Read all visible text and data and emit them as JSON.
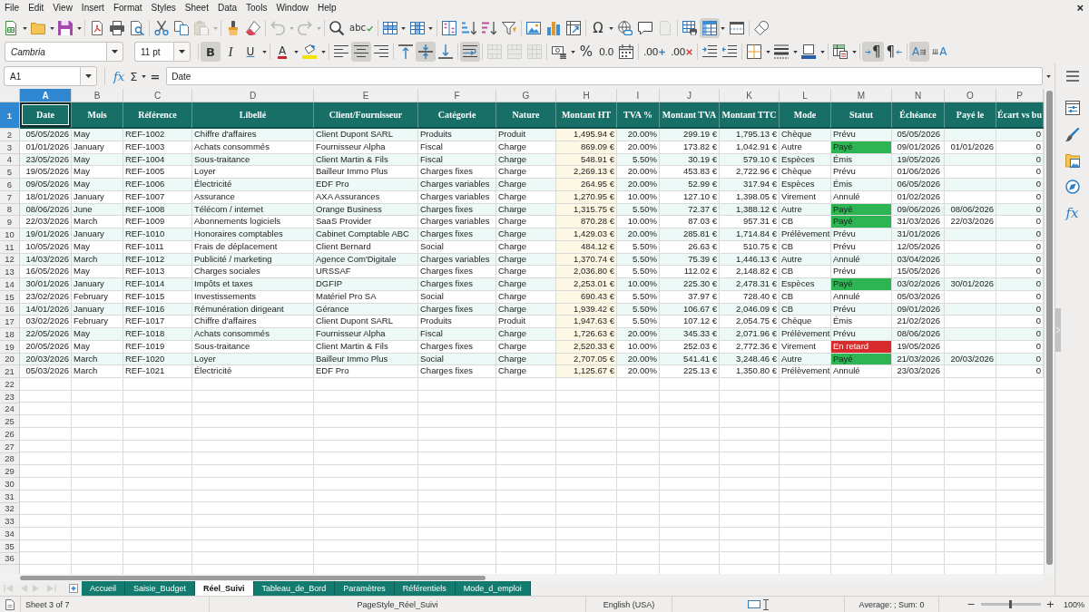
{
  "menu_bar": {
    "items": [
      "File",
      "Edit",
      "View",
      "Insert",
      "Format",
      "Styles",
      "Sheet",
      "Data",
      "Tools",
      "Window",
      "Help"
    ],
    "close_label": "×"
  },
  "standard_toolbar": [
    [
      {
        "kind": "new",
        "pressed": false,
        "disabled": false,
        "dropdown": true
      },
      {
        "kind": "open",
        "pressed": false,
        "disabled": false,
        "dropdown": true
      },
      {
        "kind": "save",
        "pressed": false,
        "disabled": false,
        "dropdown": true
      }
    ],
    [
      {
        "kind": "export-pdf",
        "pressed": false,
        "disabled": false,
        "dropdown": false
      },
      {
        "kind": "print",
        "pressed": false,
        "disabled": false,
        "dropdown": false
      },
      {
        "kind": "print-preview",
        "pressed": false,
        "disabled": false,
        "dropdown": false
      }
    ],
    [
      {
        "kind": "cut",
        "pressed": false,
        "disabled": false,
        "dropdown": false
      },
      {
        "kind": "copy",
        "pressed": false,
        "disabled": false,
        "dropdown": false
      },
      {
        "kind": "paste",
        "pressed": false,
        "disabled": true,
        "dropdown": true
      }
    ],
    [
      {
        "kind": "clone-formatting",
        "pressed": false,
        "disabled": false,
        "dropdown": false
      },
      {
        "kind": "clear-formatting",
        "pressed": false,
        "disabled": false,
        "dropdown": false
      }
    ],
    [
      {
        "kind": "undo",
        "pressed": false,
        "disabled": true,
        "dropdown": true
      },
      {
        "kind": "redo",
        "pressed": false,
        "disabled": true,
        "dropdown": true
      }
    ],
    [
      {
        "kind": "find-replace",
        "pressed": false,
        "disabled": false,
        "dropdown": false
      },
      {
        "kind": "spelling",
        "label": "abc",
        "pressed": false,
        "disabled": false,
        "dropdown": false
      }
    ],
    [
      {
        "kind": "insert-row",
        "pressed": false,
        "disabled": false,
        "dropdown": true
      },
      {
        "kind": "insert-column",
        "pressed": false,
        "disabled": false,
        "dropdown": true
      }
    ],
    [
      {
        "kind": "sort",
        "pressed": false,
        "disabled": false,
        "dropdown": false
      },
      {
        "kind": "sort-ascending",
        "pressed": false,
        "disabled": false,
        "dropdown": false
      },
      {
        "kind": "sort-descending",
        "pressed": false,
        "disabled": false,
        "dropdown": false
      },
      {
        "kind": "autofilter",
        "pressed": false,
        "disabled": false,
        "dropdown": false
      }
    ],
    [
      {
        "kind": "insert-image",
        "pressed": false,
        "disabled": false,
        "dropdown": false
      },
      {
        "kind": "insert-chart",
        "pressed": false,
        "disabled": false,
        "dropdown": false
      },
      {
        "kind": "pivot-table",
        "pressed": false,
        "disabled": false,
        "dropdown": false
      }
    ],
    [
      {
        "kind": "special-character",
        "label": "Ω",
        "pressed": false,
        "disabled": false,
        "dropdown": true
      },
      {
        "kind": "hyperlink",
        "pressed": false,
        "disabled": false,
        "dropdown": false
      },
      {
        "kind": "comment",
        "pressed": false,
        "disabled": false,
        "dropdown": false
      },
      {
        "kind": "header-footer",
        "pressed": false,
        "disabled": true,
        "dropdown": false
      }
    ],
    [
      {
        "kind": "print-area",
        "pressed": false,
        "disabled": false,
        "dropdown": false
      },
      {
        "kind": "freeze-panes",
        "pressed": true,
        "disabled": false,
        "dropdown": true
      },
      {
        "kind": "split-window",
        "pressed": false,
        "disabled": false,
        "dropdown": false
      }
    ],
    [
      {
        "kind": "shapes",
        "pressed": false,
        "disabled": false,
        "dropdown": false
      }
    ]
  ],
  "formatting_toolbar": {
    "font_name": "Cambria",
    "font_size": "11 pt",
    "groups": [
      [
        {
          "kind": "bold",
          "label": "B",
          "pressed": true,
          "disabled": false,
          "dropdown": false
        },
        {
          "kind": "italic",
          "label": "I",
          "pressed": false,
          "disabled": false,
          "dropdown": false
        },
        {
          "kind": "underline",
          "label": "U",
          "pressed": false,
          "disabled": false,
          "dropdown": true
        }
      ],
      [
        {
          "kind": "font-color",
          "label": "A",
          "pressed": false,
          "disabled": false,
          "dropdown": true
        },
        {
          "kind": "highlight",
          "pressed": false,
          "disabled": false,
          "dropdown": true
        }
      ],
      [
        {
          "kind": "align-left",
          "pressed": false,
          "disabled": false,
          "dropdown": false
        },
        {
          "kind": "align-center",
          "pressed": true,
          "disabled": false,
          "dropdown": false
        },
        {
          "kind": "align-right",
          "pressed": false,
          "disabled": false,
          "dropdown": false
        }
      ],
      [
        {
          "kind": "align-top",
          "pressed": false,
          "disabled": false,
          "dropdown": false
        },
        {
          "kind": "align-middle",
          "pressed": true,
          "disabled": false,
          "dropdown": false
        },
        {
          "kind": "align-bottom",
          "pressed": false,
          "disabled": false,
          "dropdown": false
        }
      ],
      [
        {
          "kind": "wrap-text",
          "pressed": true,
          "disabled": false,
          "dropdown": false
        }
      ],
      [
        {
          "kind": "merge-center",
          "pressed": false,
          "disabled": true,
          "dropdown": false
        },
        {
          "kind": "merge-cells",
          "pressed": false,
          "disabled": true,
          "dropdown": false
        },
        {
          "kind": "unmerge-cells",
          "pressed": false,
          "disabled": true,
          "dropdown": false
        }
      ],
      [
        {
          "kind": "currency-format",
          "pressed": false,
          "disabled": false,
          "dropdown": true
        },
        {
          "kind": "percent-format",
          "label": "%",
          "pressed": false,
          "disabled": false,
          "dropdown": false
        },
        {
          "kind": "number-format",
          "label": "0.0",
          "pressed": false,
          "disabled": false,
          "dropdown": false
        },
        {
          "kind": "date-format",
          "pressed": false,
          "disabled": false,
          "dropdown": false
        }
      ],
      [
        {
          "kind": "add-decimal",
          "label": ".00",
          "pressed": false,
          "disabled": false,
          "dropdown": false
        },
        {
          "kind": "delete-decimal",
          "label": ".00",
          "pressed": false,
          "disabled": false,
          "dropdown": false
        }
      ],
      [
        {
          "kind": "increase-indent",
          "pressed": false,
          "disabled": false,
          "dropdown": false
        },
        {
          "kind": "decrease-indent",
          "pressed": false,
          "disabled": false,
          "dropdown": false
        }
      ],
      [
        {
          "kind": "borders",
          "pressed": false,
          "disabled": false,
          "dropdown": true
        },
        {
          "kind": "border-style",
          "pressed": false,
          "disabled": false,
          "dropdown": true
        },
        {
          "kind": "border-color",
          "pressed": false,
          "disabled": false,
          "dropdown": true
        }
      ],
      [
        {
          "kind": "conditional-format",
          "pressed": false,
          "disabled": false,
          "dropdown": true
        }
      ],
      [
        {
          "kind": "left-to-right",
          "label": "¶",
          "pressed": true,
          "disabled": false,
          "dropdown": false
        },
        {
          "kind": "right-to-left",
          "label": "¶",
          "pressed": false,
          "disabled": false,
          "dropdown": false
        }
      ],
      [
        {
          "kind": "text-horizontal",
          "label": "A",
          "pressed": true,
          "disabled": false,
          "dropdown": false
        },
        {
          "kind": "text-vertical",
          "label": "A",
          "pressed": false,
          "disabled": false,
          "dropdown": false
        }
      ]
    ]
  },
  "formula_bar": {
    "cell_reference": "A1",
    "function_wizard_label": "fx",
    "sum_label": "Σ",
    "equals_label": "=",
    "content": "Date"
  },
  "sheet": {
    "columns": [
      {
        "letter": "A",
        "selected": true
      },
      {
        "letter": "B",
        "selected": false
      },
      {
        "letter": "C",
        "selected": false
      },
      {
        "letter": "D",
        "selected": false
      },
      {
        "letter": "E",
        "selected": false
      },
      {
        "letter": "F",
        "selected": false
      },
      {
        "letter": "G",
        "selected": false
      },
      {
        "letter": "H",
        "selected": false
      },
      {
        "letter": "I",
        "selected": false
      },
      {
        "letter": "J",
        "selected": false
      },
      {
        "letter": "K",
        "selected": false
      },
      {
        "letter": "L",
        "selected": false
      },
      {
        "letter": "M",
        "selected": false
      },
      {
        "letter": "N",
        "selected": false
      },
      {
        "letter": "O",
        "selected": false
      },
      {
        "letter": "P",
        "selected": false
      }
    ],
    "header_row": {
      "number": "1",
      "selected": true,
      "cells": [
        {
          "text": "Date",
          "selected": true
        },
        {
          "text": "Mois",
          "selected": false
        },
        {
          "text": "Référence",
          "selected": false
        },
        {
          "text": "Libellé",
          "selected": false
        },
        {
          "text": "Client/Fournisseur",
          "selected": false
        },
        {
          "text": "Catégorie",
          "selected": false
        },
        {
          "text": "Nature",
          "selected": false
        },
        {
          "text": "Montant HT",
          "selected": false
        },
        {
          "text": "TVA %",
          "selected": false
        },
        {
          "text": "Montant TVA",
          "selected": false
        },
        {
          "text": "Montant TTC",
          "selected": false
        },
        {
          "text": "Mode",
          "selected": false
        },
        {
          "text": "Statut",
          "selected": false
        },
        {
          "text": "Échéance",
          "selected": false
        },
        {
          "text": "Payé le",
          "selected": false
        },
        {
          "text": "Écart vs bu",
          "selected": false
        }
      ]
    },
    "rows": [
      {
        "number": "2",
        "selected": false,
        "date": "05/05/2026",
        "mois": "May",
        "reference": "REF-1002",
        "libelle": "Chiffre d'affaires",
        "client_fournisseur": "Client Dupont SARL",
        "categorie": "Produits",
        "nature": "Produit",
        "montant_ht": "1,495.94 €",
        "tva": "20.00%",
        "montant_tva": "299.19 €",
        "montant_ttc": "1,795.13 €",
        "mode": "Chèque",
        "statut": "Prévu",
        "echeance": "05/05/2026",
        "column_16": "0"
      },
      {
        "number": "3",
        "selected": false,
        "date": "01/01/2026",
        "mois": "January",
        "reference": "REF-1003",
        "libelle": "Achats consommés",
        "client_fournisseur": "Fournisseur Alpha",
        "categorie": "Fiscal",
        "nature": "Charge",
        "montant_ht": "869.09 €",
        "tva": "20.00%",
        "montant_tva": "173.82 €",
        "montant_ttc": "1,042.91 €",
        "mode": "Autre",
        "statut": "Payé",
        "color": "#2db553",
        "echeance": "09/01/2026",
        "paye_le": "01/01/2026",
        "column_16": "0"
      },
      {
        "number": "4",
        "selected": false,
        "date": "23/05/2026",
        "mois": "May",
        "reference": "REF-1004",
        "libelle": "Sous-traitance",
        "client_fournisseur": "Client Martin & Fils",
        "categorie": "Fiscal",
        "nature": "Charge",
        "montant_ht": "548.91 €",
        "tva": "5.50%",
        "montant_tva": "30.19 €",
        "montant_ttc": "579.10 €",
        "mode": "Espèces",
        "statut": "Émis",
        "echeance": "19/05/2026",
        "column_16": "0"
      },
      {
        "number": "5",
        "selected": false,
        "date": "19/05/2026",
        "mois": "May",
        "reference": "REF-1005",
        "libelle": "Loyer",
        "client_fournisseur": "Bailleur Immo Plus",
        "categorie": "Charges fixes",
        "nature": "Charge",
        "montant_ht": "2,269.13 €",
        "tva": "20.00%",
        "montant_tva": "453.83 €",
        "montant_ttc": "2,722.96 €",
        "mode": "Chèque",
        "statut": "Prévu",
        "echeance": "01/06/2026",
        "column_16": "0"
      },
      {
        "number": "6",
        "selected": false,
        "date": "09/05/2026",
        "mois": "May",
        "reference": "REF-1006",
        "libelle": "Électricité",
        "client_fournisseur": "EDF Pro",
        "categorie": "Charges variables",
        "nature": "Charge",
        "montant_ht": "264.95 €",
        "tva": "20.00%",
        "montant_tva": "52.99 €",
        "montant_ttc": "317.94 €",
        "mode": "Espèces",
        "statut": "Émis",
        "echeance": "06/05/2026",
        "column_16": "0"
      },
      {
        "number": "7",
        "selected": false,
        "date": "18/01/2026",
        "mois": "January",
        "reference": "REF-1007",
        "libelle": "Assurance",
        "client_fournisseur": "AXA Assurances",
        "categorie": "Charges variables",
        "nature": "Charge",
        "montant_ht": "1,270.95 €",
        "tva": "10.00%",
        "montant_tva": "127.10 €",
        "montant_ttc": "1,398.05 €",
        "mode": "Virement",
        "statut": "Annulé",
        "echeance": "01/02/2026",
        "column_16": "0"
      },
      {
        "number": "8",
        "selected": false,
        "date": "08/06/2026",
        "mois": "June",
        "reference": "REF-1008",
        "libelle": "Télécom / internet",
        "client_fournisseur": "Orange Business",
        "categorie": "Charges fixes",
        "nature": "Charge",
        "montant_ht": "1,315.75 €",
        "tva": "5.50%",
        "montant_tva": "72.37 €",
        "montant_ttc": "1,388.12 €",
        "mode": "Autre",
        "statut": "Payé",
        "color": "#2db553",
        "echeance": "09/06/2026",
        "paye_le": "08/06/2026",
        "column_16": "0"
      },
      {
        "number": "9",
        "selected": false,
        "date": "22/03/2026",
        "mois": "March",
        "reference": "REF-1009",
        "libelle": "Abonnements logiciels",
        "client_fournisseur": "SaaS Provider",
        "categorie": "Charges variables",
        "nature": "Charge",
        "montant_ht": "870.28 €",
        "tva": "10.00%",
        "montant_tva": "87.03 €",
        "montant_ttc": "957.31 €",
        "mode": "CB",
        "statut": "Payé",
        "color": "#2db553",
        "echeance": "31/03/2026",
        "paye_le": "22/03/2026",
        "column_16": "0"
      },
      {
        "number": "10",
        "selected": false,
        "date": "19/01/2026",
        "mois": "January",
        "reference": "REF-1010",
        "libelle": "Honoraires comptables",
        "client_fournisseur": "Cabinet Comptable ABC",
        "categorie": "Charges fixes",
        "nature": "Charge",
        "montant_ht": "1,429.03 €",
        "tva": "20.00%",
        "montant_tva": "285.81 €",
        "montant_ttc": "1,714.84 €",
        "mode": "Prélèvement",
        "statut": "Prévu",
        "echeance": "31/01/2026",
        "column_16": "0"
      },
      {
        "number": "11",
        "selected": false,
        "date": "10/05/2026",
        "mois": "May",
        "reference": "REF-1011",
        "libelle": "Frais de déplacement",
        "client_fournisseur": "Client Bernard",
        "categorie": "Social",
        "nature": "Charge",
        "montant_ht": "484.12 €",
        "tva": "5.50%",
        "montant_tva": "26.63 €",
        "montant_ttc": "510.75 €",
        "mode": "CB",
        "statut": "Prévu",
        "echeance": "12/05/2026",
        "column_16": "0"
      },
      {
        "number": "12",
        "selected": false,
        "date": "14/03/2026",
        "mois": "March",
        "reference": "REF-1012",
        "libelle": "Publicité / marketing",
        "client_fournisseur": "Agence Com'Digitale",
        "categorie": "Charges variables",
        "nature": "Charge",
        "montant_ht": "1,370.74 €",
        "tva": "5.50%",
        "montant_tva": "75.39 €",
        "montant_ttc": "1,446.13 €",
        "mode": "Autre",
        "statut": "Annulé",
        "echeance": "03/04/2026",
        "column_16": "0"
      },
      {
        "number": "13",
        "selected": false,
        "date": "16/05/2026",
        "mois": "May",
        "reference": "REF-1013",
        "libelle": "Charges sociales",
        "client_fournisseur": "URSSAF",
        "categorie": "Charges fixes",
        "nature": "Charge",
        "montant_ht": "2,036.80 €",
        "tva": "5.50%",
        "montant_tva": "112.02 €",
        "montant_ttc": "2,148.82 €",
        "mode": "CB",
        "statut": "Prévu",
        "echeance": "15/05/2026",
        "column_16": "0"
      },
      {
        "number": "14",
        "selected": false,
        "date": "30/01/2026",
        "mois": "January",
        "reference": "REF-1014",
        "libelle": "Impôts et taxes",
        "client_fournisseur": "DGFIP",
        "categorie": "Charges fixes",
        "nature": "Charge",
        "montant_ht": "2,253.01 €",
        "tva": "10.00%",
        "montant_tva": "225.30 €",
        "montant_ttc": "2,478.31 €",
        "mode": "Espèces",
        "statut": "Payé",
        "color": "#2db553",
        "echeance": "03/02/2026",
        "paye_le": "30/01/2026",
        "column_16": "0"
      },
      {
        "number": "15",
        "selected": false,
        "date": "23/02/2026",
        "mois": "February",
        "reference": "REF-1015",
        "libelle": "Investissements",
        "client_fournisseur": "Matériel Pro SA",
        "categorie": "Social",
        "nature": "Charge",
        "montant_ht": "690.43 €",
        "tva": "5.50%",
        "montant_tva": "37.97 €",
        "montant_ttc": "728.40 €",
        "mode": "CB",
        "statut": "Annulé",
        "echeance": "05/03/2026",
        "column_16": "0"
      },
      {
        "number": "16",
        "selected": false,
        "date": "14/01/2026",
        "mois": "January",
        "reference": "REF-1016",
        "libelle": "Rémunération dirigeant",
        "client_fournisseur": "Gérance",
        "categorie": "Charges fixes",
        "nature": "Charge",
        "montant_ht": "1,939.42 €",
        "tva": "5.50%",
        "montant_tva": "106.67 €",
        "montant_ttc": "2,046.09 €",
        "mode": "CB",
        "statut": "Prévu",
        "echeance": "09/01/2026",
        "column_16": "0"
      },
      {
        "number": "17",
        "selected": false,
        "date": "03/02/2026",
        "mois": "February",
        "reference": "REF-1017",
        "libelle": "Chiffre d'affaires",
        "client_fournisseur": "Client Dupont SARL",
        "categorie": "Produits",
        "nature": "Produit",
        "montant_ht": "1,947.63 €",
        "tva": "5.50%",
        "montant_tva": "107.12 €",
        "montant_ttc": "2,054.75 €",
        "mode": "Chèque",
        "statut": "Émis",
        "echeance": "21/02/2026",
        "column_16": "0"
      },
      {
        "number": "18",
        "selected": false,
        "date": "22/05/2026",
        "mois": "May",
        "reference": "REF-1018",
        "libelle": "Achats consommés",
        "client_fournisseur": "Fournisseur Alpha",
        "categorie": "Fiscal",
        "nature": "Charge",
        "montant_ht": "1,726.63 €",
        "tva": "20.00%",
        "montant_tva": "345.33 €",
        "montant_ttc": "2,071.96 €",
        "mode": "Prélèvement",
        "statut": "Prévu",
        "echeance": "08/06/2026",
        "column_16": "0"
      },
      {
        "number": "19",
        "selected": false,
        "date": "20/05/2026",
        "mois": "May",
        "reference": "REF-1019",
        "libelle": "Sous-traitance",
        "client_fournisseur": "Client Martin & Fils",
        "categorie": "Charges fixes",
        "nature": "Charge",
        "montant_ht": "2,520.33 €",
        "tva": "10.00%",
        "montant_tva": "252.03 €",
        "montant_ttc": "2,772.36 €",
        "mode": "Virement",
        "statut": "En retard",
        "color": "#d92b2b",
        "echeance": "19/05/2026",
        "column_16": "0"
      },
      {
        "number": "20",
        "selected": false,
        "date": "20/03/2026",
        "mois": "March",
        "reference": "REF-1020",
        "libelle": "Loyer",
        "client_fournisseur": "Bailleur Immo Plus",
        "categorie": "Social",
        "nature": "Charge",
        "montant_ht": "2,707.05 €",
        "tva": "20.00%",
        "montant_tva": "541.41 €",
        "montant_ttc": "3,248.46 €",
        "mode": "Autre",
        "statut": "Payé",
        "color": "#2db553",
        "echeance": "21/03/2026",
        "paye_le": "20/03/2026",
        "column_16": "0"
      },
      {
        "number": "21",
        "selected": false,
        "date": "05/03/2026",
        "mois": "March",
        "reference": "REF-1021",
        "libelle": "Électricité",
        "client_fournisseur": "EDF Pro",
        "categorie": "Charges fixes",
        "nature": "Charge",
        "montant_ht": "1,125.67 €",
        "tva": "20.00%",
        "montant_tva": "225.13 €",
        "montant_ttc": "1,350.80 €",
        "mode": "Prélèvement",
        "statut": "Annulé",
        "echeance": "23/03/2026",
        "column_16": "0"
      }
    ],
    "empty_rows": [
      {
        "number": "22",
        "selected": false
      },
      {
        "number": "23",
        "selected": false
      },
      {
        "number": "24",
        "selected": false
      },
      {
        "number": "25",
        "selected": false
      },
      {
        "number": "26",
        "selected": false
      },
      {
        "number": "27",
        "selected": false
      },
      {
        "number": "28",
        "selected": false
      },
      {
        "number": "29",
        "selected": false
      },
      {
        "number": "30",
        "selected": false
      },
      {
        "number": "31",
        "selected": false
      },
      {
        "number": "32",
        "selected": false
      },
      {
        "number": "33",
        "selected": false
      },
      {
        "number": "34",
        "selected": false
      },
      {
        "number": "35",
        "selected": false
      },
      {
        "number": "36",
        "selected": false
      }
    ]
  },
  "sidebar": {
    "decks": [
      {
        "kind": "properties",
        "selected": false
      },
      {
        "kind": "styles",
        "selected": false
      },
      {
        "kind": "gallery",
        "selected": false
      },
      {
        "kind": "navigator",
        "selected": false
      },
      {
        "kind": "functions",
        "label": "fx",
        "selected": false
      }
    ]
  },
  "sheet_tabs": {
    "navigation": [
      {
        "kind": "first",
        "disabled": true
      },
      {
        "kind": "previous",
        "disabled": true
      },
      {
        "kind": "next",
        "disabled": true
      },
      {
        "kind": "last",
        "disabled": true
      }
    ],
    "tabs": [
      {
        "label": "Accueil",
        "selected": false
      },
      {
        "label": "Saisie_Budget",
        "selected": false
      },
      {
        "label": "Réel_Suivi",
        "selected": true
      },
      {
        "label": "Tableau_de_Bord",
        "selected": false
      },
      {
        "label": "Paramètres",
        "selected": false
      },
      {
        "label": "Référentiels",
        "selected": false
      },
      {
        "label": "Mode_d_emploi",
        "selected": false
      }
    ]
  },
  "status_bar": {
    "sheet_position": "Sheet 3 of 7",
    "page_style": "PageStyle_Réel_Suivi",
    "language": "English (USA)",
    "selection_summary": "Average: ; Sum: 0",
    "zoom": {
      "decrease_label": "−",
      "increase_label": "+",
      "level": 0.5,
      "percent": "100%"
    }
  }
}
